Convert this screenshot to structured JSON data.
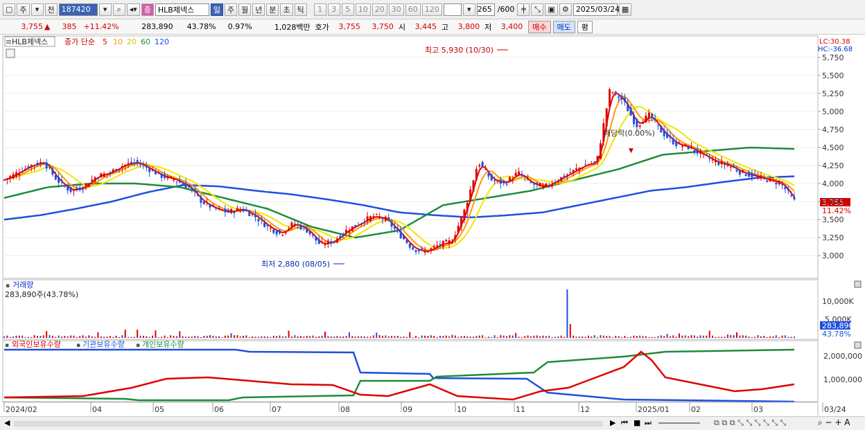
{
  "toolbar": {
    "period_short": "주",
    "prev_label": "전",
    "stock_code": "187420",
    "stock_name": "HLB제넥스",
    "intervals": [
      "일",
      "주",
      "월",
      "년",
      "분",
      "초",
      "틱"
    ],
    "active_interval": "일",
    "numbers": [
      "1",
      "3",
      "5",
      "10",
      "20",
      "30",
      "60",
      "120"
    ],
    "count_value": "265",
    "count_max": "/600",
    "date": "2025/03/24"
  },
  "quote": {
    "price": "3,755",
    "change_arrow": "▲",
    "change": "385",
    "change_pct": "+11.42%",
    "volume": "283,890",
    "turnover_pct": "43.78%",
    "ratio": "0.97%",
    "amount": "1,028백만",
    "hoga_label": "호가",
    "ask": "3,755",
    "bid": "3,750",
    "open_label": "시",
    "open": "3,445",
    "high_label": "고",
    "high": "3,800",
    "low_label": "저",
    "low": "3,400",
    "buy": "매수",
    "sell": "매도",
    "avg": "평"
  },
  "price_panel": {
    "name_tag": "HLB제넥스",
    "ma_title": "종가 단순",
    "ma_periods": [
      "5",
      "10",
      "20",
      "60",
      "120"
    ],
    "ma_colors": [
      "#e00000",
      "#ff9800",
      "#f2e600",
      "#1e8c3a",
      "#1f4fe0"
    ],
    "lc": "LC:30.38",
    "hc": "HC:-36.68",
    "high_annot": "최고 5,930 (10/30)",
    "low_annot": "최저 2,880 (08/05)",
    "div_annot": "배당락(0.00%)",
    "price_tag": "3,755",
    "pct_tag": "11.42%",
    "y_ticks": [
      "5,750",
      "5,500",
      "5,250",
      "5,000",
      "4,750",
      "4,500",
      "4,250",
      "4,000",
      "3,750",
      "3,500",
      "3,250",
      "3,000"
    ]
  },
  "volume_panel": {
    "title": "거래량",
    "info": "283,890주(43.78%)",
    "y_ticks": [
      "10,000K",
      "5,000K"
    ],
    "tag": "283,890",
    "tag_pct": "43.78%"
  },
  "holder_panel": {
    "labels": [
      "외국인보유수량",
      "기관보유수량",
      "개인보유수량"
    ],
    "colors": [
      "#e00000",
      "#1f4fe0",
      "#1e8c3a"
    ],
    "y_ticks": [
      "2,000,000",
      "1,000,000"
    ]
  },
  "x_axis": {
    "labels": [
      "2024/02",
      "04",
      "05",
      "06",
      "07",
      "08",
      "09",
      "10",
      "11",
      "12",
      "2025/01",
      "02",
      "03",
      "03/24"
    ]
  },
  "chart_data": {
    "type": "candlestick",
    "price_ylim": [
      2800,
      5950
    ],
    "highest": {
      "value": 5930,
      "date": "10/30"
    },
    "lowest": {
      "value": 2880,
      "date": "08/05"
    },
    "close_series": [
      4050,
      4150,
      4250,
      4300,
      4050,
      3900,
      3950,
      4100,
      4150,
      4250,
      4300,
      4200,
      4100,
      4050,
      3950,
      3750,
      3650,
      3600,
      3650,
      3550,
      3400,
      3300,
      3450,
      3350,
      3150,
      3200,
      3350,
      3450,
      3550,
      3500,
      3300,
      3100,
      3050,
      3150,
      3200,
      3650,
      4300,
      4050,
      4000,
      4150,
      4000,
      3950,
      4050,
      4150,
      4250,
      4300,
      5300,
      5150,
      4800,
      4950,
      4700,
      4550,
      4500,
      4400,
      4300,
      4250,
      4150,
      4100,
      4050,
      4000,
      3755
    ],
    "ma120_series": [
      3500,
      3560,
      3650,
      3750,
      3880,
      3980,
      3960,
      3900,
      3850,
      3780,
      3700,
      3600,
      3560,
      3530,
      3560,
      3600,
      3700,
      3800,
      3900,
      3950,
      4020,
      4080,
      4100
    ],
    "ma60_series": [
      3800,
      3950,
      4000,
      4000,
      3950,
      3800,
      3650,
      3400,
      3250,
      3350,
      3700,
      3800,
      3900,
      4050,
      4200,
      4400,
      4450,
      4500,
      4480
    ]
  },
  "bottom": {
    "nav_icons": [
      "play-icon",
      "first-icon",
      "stop-icon",
      "last-icon"
    ]
  }
}
